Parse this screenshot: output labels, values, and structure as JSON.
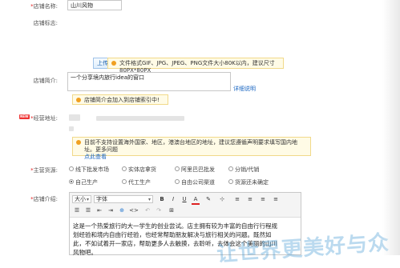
{
  "shop_name": {
    "label": "店铺名称:",
    "value": "山川风物"
  },
  "shop_logo": {
    "label": "店铺标志:"
  },
  "upload": {
    "button": "上传图标",
    "hint": "文件格式GIF、JPG、JPEG、PNG文件大小80K以内，建议尺寸80PX*80PX"
  },
  "shop_intro": {
    "label": "店铺简介:",
    "value": "一个分享境内旅行idea的窗口",
    "detail_link": "详细说明",
    "hint": "店铺简介会加入到店铺索引中!"
  },
  "address": {
    "badge": "NEW",
    "label": "经营地址:",
    "hint": "目前不支持设置海外国家、地区，港澳台地区的地址，建议您遵循声明要求填写国内地址。更多问题",
    "hint_link": "点此查看"
  },
  "source": {
    "label": "主营货源:",
    "options": [
      "线下批发市场",
      "实体店拿货",
      "阿里巴巴批发",
      "分销/代销",
      "自己生产",
      "代工生产",
      "自由公司渠道",
      "货源还未确定"
    ],
    "selected": "自己生产"
  },
  "intro_editor": {
    "label": "店铺介绍:",
    "size_select": "大小",
    "font_select": "字体",
    "toolbar_row1": [
      "B",
      "I",
      "U",
      "A",
      "✎",
      "⊹",
      "≡",
      "≡",
      "≡",
      "≡"
    ],
    "toolbar_row2": [
      "☰",
      "☰",
      "⇤",
      "⇥",
      "⊕",
      "<>",
      "↶",
      "↷",
      "⊞"
    ],
    "content": [
      "这是一个热爱旅行的大一学生的创业尝试。店主拥有较为丰富的自由行行程规",
      "划经验和境内自由行经验，也经常帮助朋友解决与旅行相关的问题。既然如",
      "此，不如试着开一家店，帮助更多人去触摸，去聆听，去体会这个美丽的山川",
      "风物吧。"
    ]
  },
  "watermark": "让世界更美好与众"
}
